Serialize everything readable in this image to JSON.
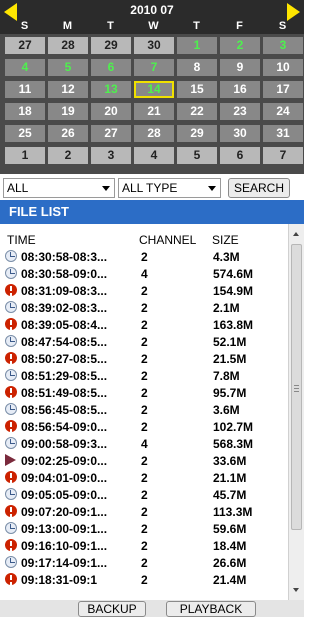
{
  "calendar": {
    "month_label": "2010 07",
    "weekdays": [
      "S",
      "M",
      "T",
      "W",
      "T",
      "F",
      "S"
    ],
    "weeks": [
      [
        {
          "d": "27",
          "t": "off"
        },
        {
          "d": "28",
          "t": "off"
        },
        {
          "d": "29",
          "t": "off"
        },
        {
          "d": "30",
          "t": "off"
        },
        {
          "d": "1",
          "t": "rec"
        },
        {
          "d": "2",
          "t": "rec"
        },
        {
          "d": "3",
          "t": "rec"
        }
      ],
      [
        {
          "d": "4",
          "t": "rec"
        },
        {
          "d": "5",
          "t": "rec"
        },
        {
          "d": "6",
          "t": "rec"
        },
        {
          "d": "7",
          "t": "rec"
        },
        {
          "d": "8",
          "t": "n"
        },
        {
          "d": "9",
          "t": "n"
        },
        {
          "d": "10",
          "t": "n"
        }
      ],
      [
        {
          "d": "11",
          "t": "n"
        },
        {
          "d": "12",
          "t": "n"
        },
        {
          "d": "13",
          "t": "rec"
        },
        {
          "d": "14",
          "t": "sel"
        },
        {
          "d": "15",
          "t": "n"
        },
        {
          "d": "16",
          "t": "n"
        },
        {
          "d": "17",
          "t": "n"
        }
      ],
      [
        {
          "d": "18",
          "t": "n"
        },
        {
          "d": "19",
          "t": "n"
        },
        {
          "d": "20",
          "t": "n"
        },
        {
          "d": "21",
          "t": "n"
        },
        {
          "d": "22",
          "t": "n"
        },
        {
          "d": "23",
          "t": "n"
        },
        {
          "d": "24",
          "t": "n"
        }
      ],
      [
        {
          "d": "25",
          "t": "n"
        },
        {
          "d": "26",
          "t": "n"
        },
        {
          "d": "27",
          "t": "n"
        },
        {
          "d": "28",
          "t": "n"
        },
        {
          "d": "29",
          "t": "n"
        },
        {
          "d": "30",
          "t": "n"
        },
        {
          "d": "31",
          "t": "n"
        }
      ],
      [
        {
          "d": "1",
          "t": "off"
        },
        {
          "d": "2",
          "t": "off"
        },
        {
          "d": "3",
          "t": "off"
        },
        {
          "d": "4",
          "t": "off"
        },
        {
          "d": "5",
          "t": "off"
        },
        {
          "d": "6",
          "t": "off"
        },
        {
          "d": "7",
          "t": "off"
        }
      ]
    ],
    "colors": {
      "header_bg": "#2b2b2b",
      "grid_bg": "#4a4a4a",
      "cell": "#888888",
      "cell_off": "#b8b8b8",
      "record_day": "#4ef04e",
      "selected_border": "#f0e000",
      "arrow": "#ffe600"
    }
  },
  "filters": {
    "channel_value": "ALL",
    "type_value": "ALL TYPE",
    "search_label": "SEARCH"
  },
  "file_list": {
    "title": "FILE LIST",
    "title_bg": "#2c6dc6",
    "columns": {
      "time": "TIME",
      "channel": "CHANNEL",
      "size": "SIZE"
    },
    "rows": [
      {
        "icon": "clock",
        "time": "08:30:58-08:3...",
        "channel": "2",
        "size": "4.3M"
      },
      {
        "icon": "clock",
        "time": "08:30:58-09:0...",
        "channel": "4",
        "size": "574.6M"
      },
      {
        "icon": "alert",
        "time": "08:31:09-08:3...",
        "channel": "2",
        "size": "154.9M"
      },
      {
        "icon": "clock",
        "time": "08:39:02-08:3...",
        "channel": "2",
        "size": "2.1M"
      },
      {
        "icon": "alert",
        "time": "08:39:05-08:4...",
        "channel": "2",
        "size": "163.8M"
      },
      {
        "icon": "clock",
        "time": "08:47:54-08:5...",
        "channel": "2",
        "size": "52.1M"
      },
      {
        "icon": "alert",
        "time": "08:50:27-08:5...",
        "channel": "2",
        "size": "21.5M"
      },
      {
        "icon": "clock",
        "time": "08:51:29-08:5...",
        "channel": "2",
        "size": "7.8M"
      },
      {
        "icon": "alert",
        "time": "08:51:49-08:5...",
        "channel": "2",
        "size": "95.7M"
      },
      {
        "icon": "clock",
        "time": "08:56:45-08:5...",
        "channel": "2",
        "size": "3.6M"
      },
      {
        "icon": "alert",
        "time": "08:56:54-09:0...",
        "channel": "2",
        "size": "102.7M"
      },
      {
        "icon": "clock",
        "time": "09:00:58-09:3...",
        "channel": "4",
        "size": "568.3M"
      },
      {
        "icon": "play",
        "time": "09:02:25-09:0...",
        "channel": "2",
        "size": "33.6M"
      },
      {
        "icon": "alert",
        "time": "09:04:01-09:0...",
        "channel": "2",
        "size": "21.1M"
      },
      {
        "icon": "clock",
        "time": "09:05:05-09:0...",
        "channel": "2",
        "size": "45.7M"
      },
      {
        "icon": "alert",
        "time": "09:07:20-09:1...",
        "channel": "2",
        "size": "113.3M"
      },
      {
        "icon": "clock",
        "time": "09:13:00-09:1...",
        "channel": "2",
        "size": "59.6M"
      },
      {
        "icon": "alert",
        "time": "09:16:10-09:1...",
        "channel": "2",
        "size": "18.4M"
      },
      {
        "icon": "clock",
        "time": "09:17:14-09:1...",
        "channel": "2",
        "size": "26.6M"
      },
      {
        "icon": "alert",
        "time": "09:18:31-09:1",
        "channel": "2",
        "size": "21.4M"
      }
    ]
  },
  "buttons": {
    "backup_label": "BACKUP",
    "playback_label": "PLAYBACK"
  }
}
